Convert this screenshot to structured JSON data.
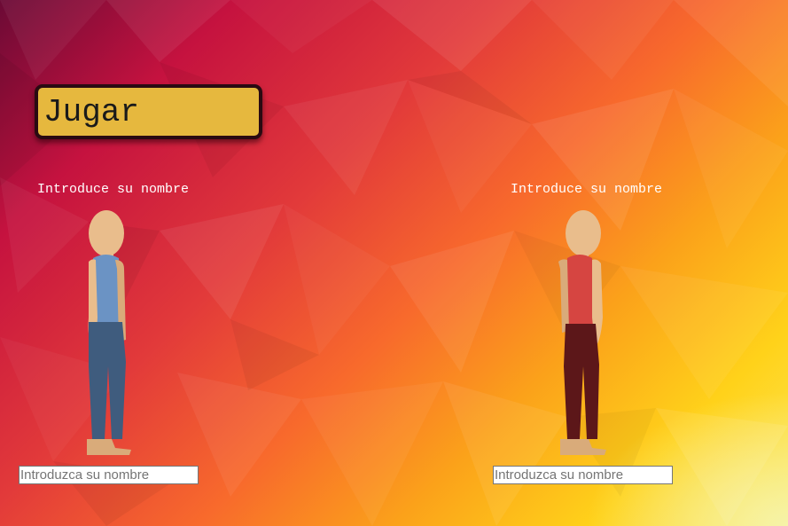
{
  "play_button": {
    "label": "Jugar"
  },
  "players": [
    {
      "label": "Introduce su nombre",
      "input_placeholder": "Introduzca su nombre",
      "input_value": "",
      "shirt_color": "#6b93c4",
      "pants_color": "#3f5c7e"
    },
    {
      "label": "Introduce su nombre",
      "input_placeholder": "Introduzca su nombre",
      "input_value": "",
      "shirt_color": "#d64541",
      "pants_color": "#5c1719"
    }
  ],
  "colors": {
    "skin": "#e9bd8c",
    "button_bg": "#e6b83e",
    "label_text": "#ffffff"
  },
  "icons": {
    "avatar": "character-avatar-icon"
  }
}
